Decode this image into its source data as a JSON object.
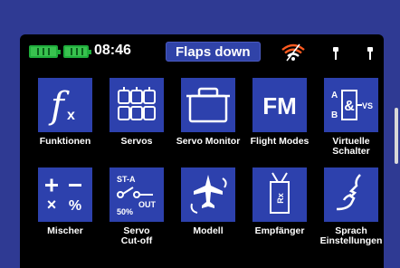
{
  "status_bar": {
    "time": "08:46",
    "flight_mode": "Flaps down",
    "colors": {
      "battery": "#39c24f",
      "wifi_outer": "#ff5a1f",
      "wifi_inner": "#ffffff"
    }
  },
  "menu": {
    "items": [
      {
        "label": "Funktionen",
        "icon": "function-icon"
      },
      {
        "label": "Servos",
        "icon": "servos-icon"
      },
      {
        "label": "Servo Monitor",
        "icon": "servo-monitor-icon"
      },
      {
        "label": "Flight Modes",
        "icon": "flight-modes-icon",
        "icon_text": "FM"
      },
      {
        "label_line1": "Virtuelle",
        "label_line2": "Schalter",
        "icon": "virtual-switch-icon",
        "icon_text_a": "A",
        "icon_text_b": "B",
        "icon_text_vs": "VS"
      },
      {
        "label": "Mischer",
        "icon": "mixer-icon"
      },
      {
        "label_line1": "Servo",
        "label_line2": "Cut-off",
        "icon": "servo-cutoff-icon",
        "icon_text_st": "ST-A",
        "icon_text_out": "OUT",
        "icon_text_pct": "50%"
      },
      {
        "label": "Modell",
        "icon": "model-icon"
      },
      {
        "label": "Empfänger",
        "icon": "receiver-icon",
        "icon_text_rx": "Rx"
      },
      {
        "label_line1": "Sprach",
        "label_line2": "Einstellungen",
        "icon": "voice-settings-icon"
      }
    ]
  },
  "theme": {
    "frame": "#2f3a93",
    "tile": "#2d41ad",
    "screen": "#000000"
  }
}
